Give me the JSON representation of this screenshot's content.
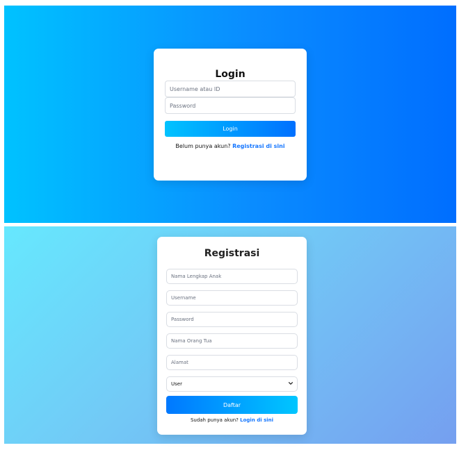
{
  "login": {
    "title": "Login",
    "username_placeholder": "Username atau ID",
    "password_placeholder": "Password",
    "submit_label": "Login",
    "switch_prompt": "Belum punya akun?",
    "switch_link": "Registrasi di sini",
    "colors": {
      "gradient_start": "#00c2ff",
      "gradient_end": "#006eff",
      "link": "#1677ff"
    }
  },
  "register": {
    "title": "Registrasi",
    "fullname_placeholder": "Nama Lengkap Anak",
    "username_placeholder": "Username",
    "password_placeholder": "Password",
    "parent_placeholder": "Nama Orang Tua",
    "address_placeholder": "Alamat",
    "role_options": [
      "User"
    ],
    "role_selected": "User",
    "submit_label": "Daftar",
    "switch_prompt": "Sudah punya akun?",
    "switch_link": "Login di sini",
    "icons": {
      "role_select": "chevron-down-icon"
    },
    "colors": {
      "gradient_start": "#66e8fe",
      "gradient_end": "#759ff0",
      "button_start": "#0078ff",
      "button_end": "#00c6ff"
    }
  }
}
